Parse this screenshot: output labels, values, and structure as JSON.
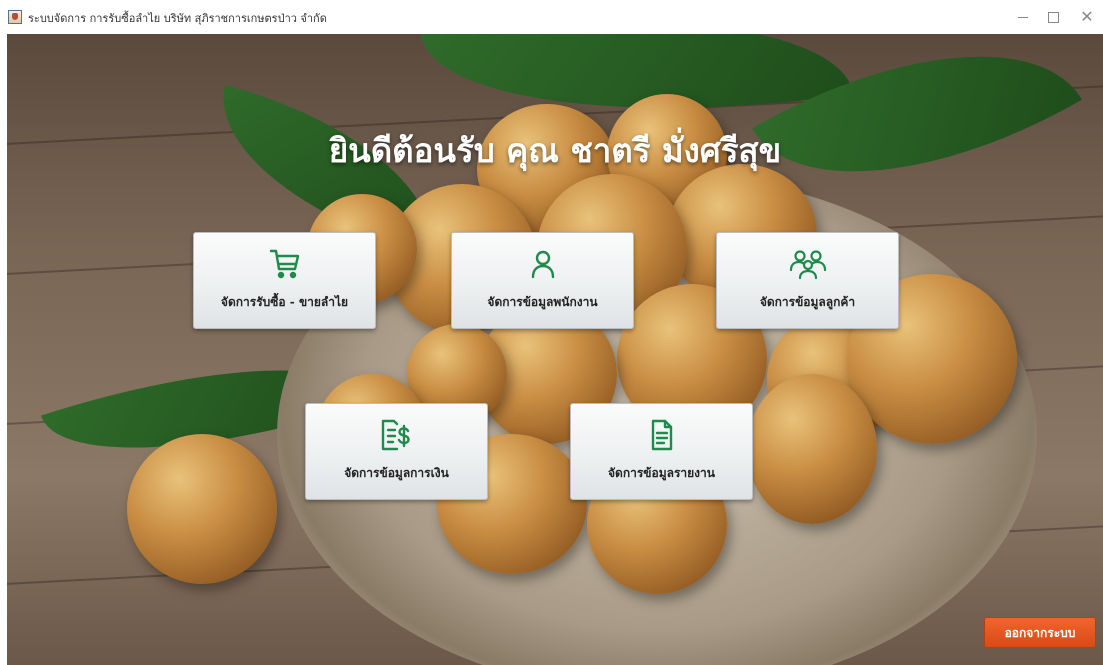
{
  "window": {
    "title": "ระบบจัดการ การรับซื้อลำไย บริษัท สุภิราชการเกษตรป่าว จำกัด",
    "icon": "java-cup-icon"
  },
  "welcome": {
    "text": "ยินดีต้อนรับ คุณ ชาตรี มั่งศรีสุข"
  },
  "menu": {
    "buy_sell": {
      "label": "จัดการรับซื้อ - ขายลำไย",
      "icon": "shopping-cart-icon"
    },
    "employee": {
      "label": "จัดการข้อมูลพนักงาน",
      "icon": "user-icon"
    },
    "customer": {
      "label": "จัดการข้อมูลลูกค้า",
      "icon": "users-group-icon"
    },
    "finance": {
      "label": "จัดการข้อมูลการเงิน",
      "icon": "receipt-dollar-icon"
    },
    "report": {
      "label": "จัดการข้อมูลรายงาน",
      "icon": "document-icon"
    }
  },
  "logout": {
    "label": "ออกจากระบบ"
  },
  "colors": {
    "icon_green": "#1e8a4c",
    "logout_orange": "#e8551f"
  }
}
